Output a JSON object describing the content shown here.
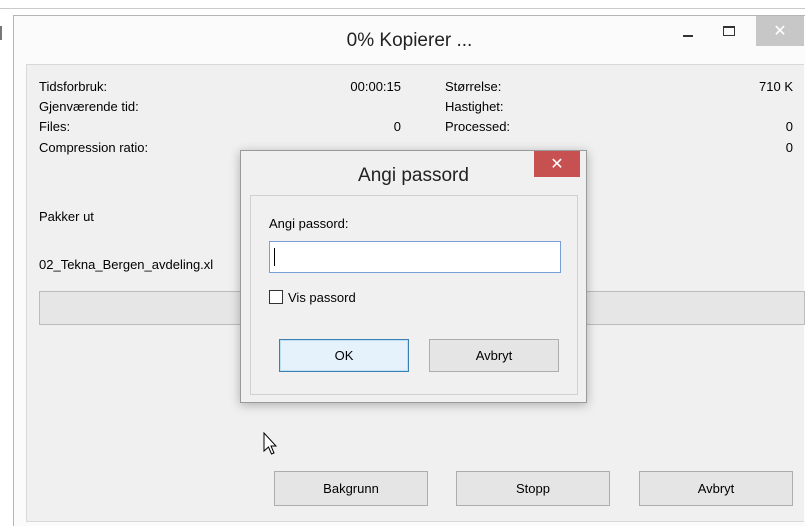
{
  "window": {
    "title": "0% Kopierer ...",
    "close_symbol": "✕"
  },
  "stats": {
    "elapsed_label": "Tidsforbruk:",
    "elapsed_value": "00:00:15",
    "remaining_label": "Gjenværende tid:",
    "files_label": "Files:",
    "files_value": "0",
    "compression_label": "Compression ratio:",
    "size_label": "Størrelse:",
    "size_value": "710 K",
    "speed_label": "Hastighet:",
    "processed_label": "Processed:",
    "processed_value": "0",
    "ratio_value": "0"
  },
  "status": {
    "action": "Pakker ut",
    "current_file": "02_Tekna_Bergen_avdeling.xl"
  },
  "progress": {
    "fraction": 0
  },
  "buttons": {
    "background": "Bakgrunn",
    "stop": "Stopp",
    "cancel": "Avbryt"
  },
  "dialog": {
    "title": "Angi passord",
    "close_symbol": "✕",
    "prompt_label": "Angi passord:",
    "password_value": "",
    "show_password_label": "Vis passord",
    "ok_label": "OK",
    "cancel_label": "Avbryt"
  },
  "colors": {
    "dialog_close": "#c75050",
    "window_close": "#c7c7c7",
    "ok_border": "#3c7fb1"
  }
}
